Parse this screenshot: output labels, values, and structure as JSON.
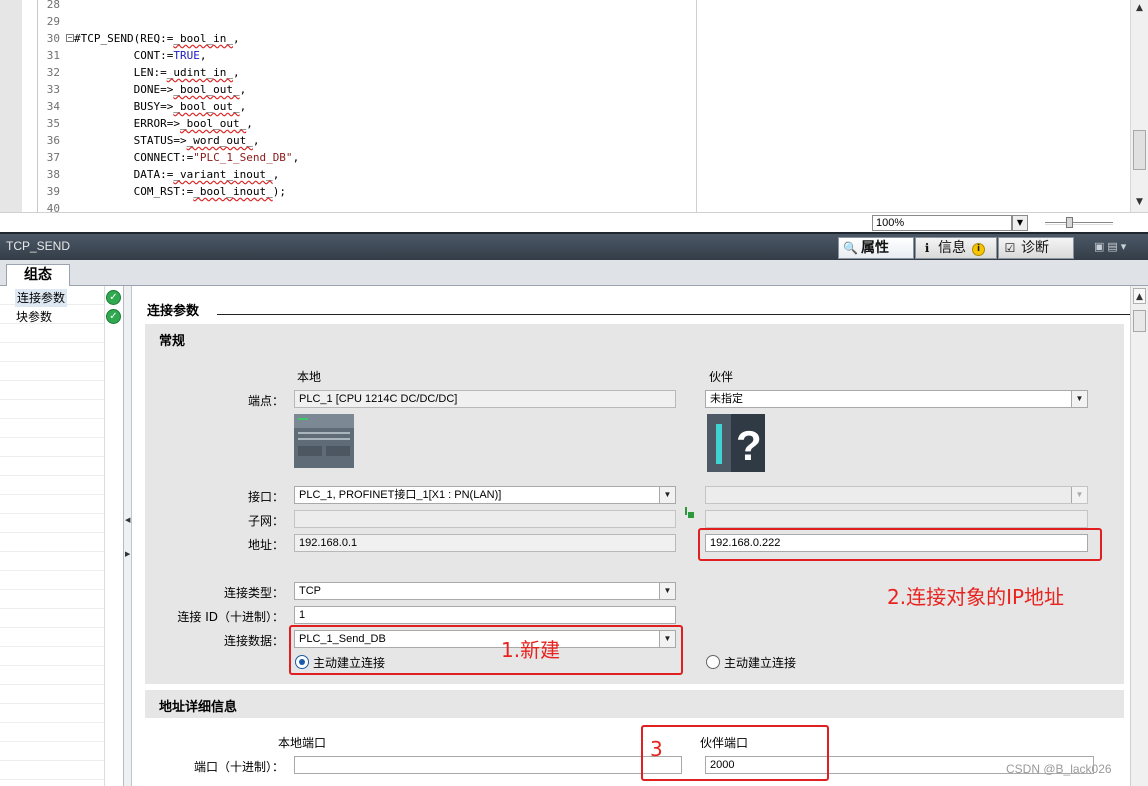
{
  "editor": {
    "lines": [
      {
        "num": "28",
        "text": ""
      },
      {
        "num": "29",
        "text": ""
      },
      {
        "num": "30",
        "text": "#TCP_SEND(REQ:=_bool_in_,"
      },
      {
        "num": "31",
        "text": "         CONT:=TRUE,"
      },
      {
        "num": "32",
        "text": "         LEN:=_udint_in_,"
      },
      {
        "num": "33",
        "text": "         DONE=>_bool_out_,"
      },
      {
        "num": "34",
        "text": "         BUSY=>_bool_out_,"
      },
      {
        "num": "35",
        "text": "         ERROR=>_bool_out_,"
      },
      {
        "num": "36",
        "text": "         STATUS=>_word_out_,"
      },
      {
        "num": "37",
        "text": "         CONNECT:=\"PLC_1_Send_DB\","
      },
      {
        "num": "38",
        "text": "         DATA:=_variant_inout_,"
      },
      {
        "num": "39",
        "text": "         COM_RST:=_bool_inout_);"
      },
      {
        "num": "40",
        "text": ""
      }
    ],
    "zoom": "100%"
  },
  "inspector": {
    "title": "TCP_SEND",
    "tabs": [
      {
        "label": "属性",
        "icon": "properties-icon"
      },
      {
        "label": "信息",
        "icon": "info-icon"
      },
      {
        "label": "诊断",
        "icon": "diagnostics-icon"
      }
    ],
    "subtab": "组态",
    "nav": [
      {
        "label": "连接参数",
        "status": "ok"
      },
      {
        "label": "块参数",
        "status": "ok"
      }
    ]
  },
  "conn_params": {
    "section_title": "连接参数",
    "general": {
      "title": "常规",
      "col_local": "本地",
      "col_partner": "伙伴",
      "endpoint_label": "端点：",
      "endpoint_local": "PLC_1 [CPU 1214C DC/DC/DC]",
      "endpoint_partner": "未指定",
      "interface_label": "接口：",
      "interface_local": "PLC_1, PROFINET接口_1[X1 : PN(LAN)]",
      "interface_partner": "",
      "subnet_label": "子网：",
      "subnet_local": "",
      "subnet_partner": "",
      "address_label": "地址：",
      "address_local": "192.168.0.1",
      "address_partner": "192.168.0.222",
      "conn_type_label": "连接类型：",
      "conn_type": "TCP",
      "conn_id_label": "连接 ID（十进制）：",
      "conn_id": "1",
      "conn_data_label": "连接数据：",
      "conn_data": "PLC_1_Send_DB",
      "active_local": "主动建立连接",
      "active_partner": "主动建立连接"
    },
    "address_details": {
      "title": "地址详细信息",
      "col_local_port": "本地端口",
      "col_partner_port": "伙伴端口",
      "port_label": "端口（十进制）：",
      "local_port": "",
      "partner_port": "2000"
    }
  },
  "annotations": {
    "note_new": "1.新建",
    "note_ip": "2.连接对象的IP地址",
    "note_port": "3",
    "color": "#e02020"
  },
  "watermark": "CSDN @B_lack026"
}
